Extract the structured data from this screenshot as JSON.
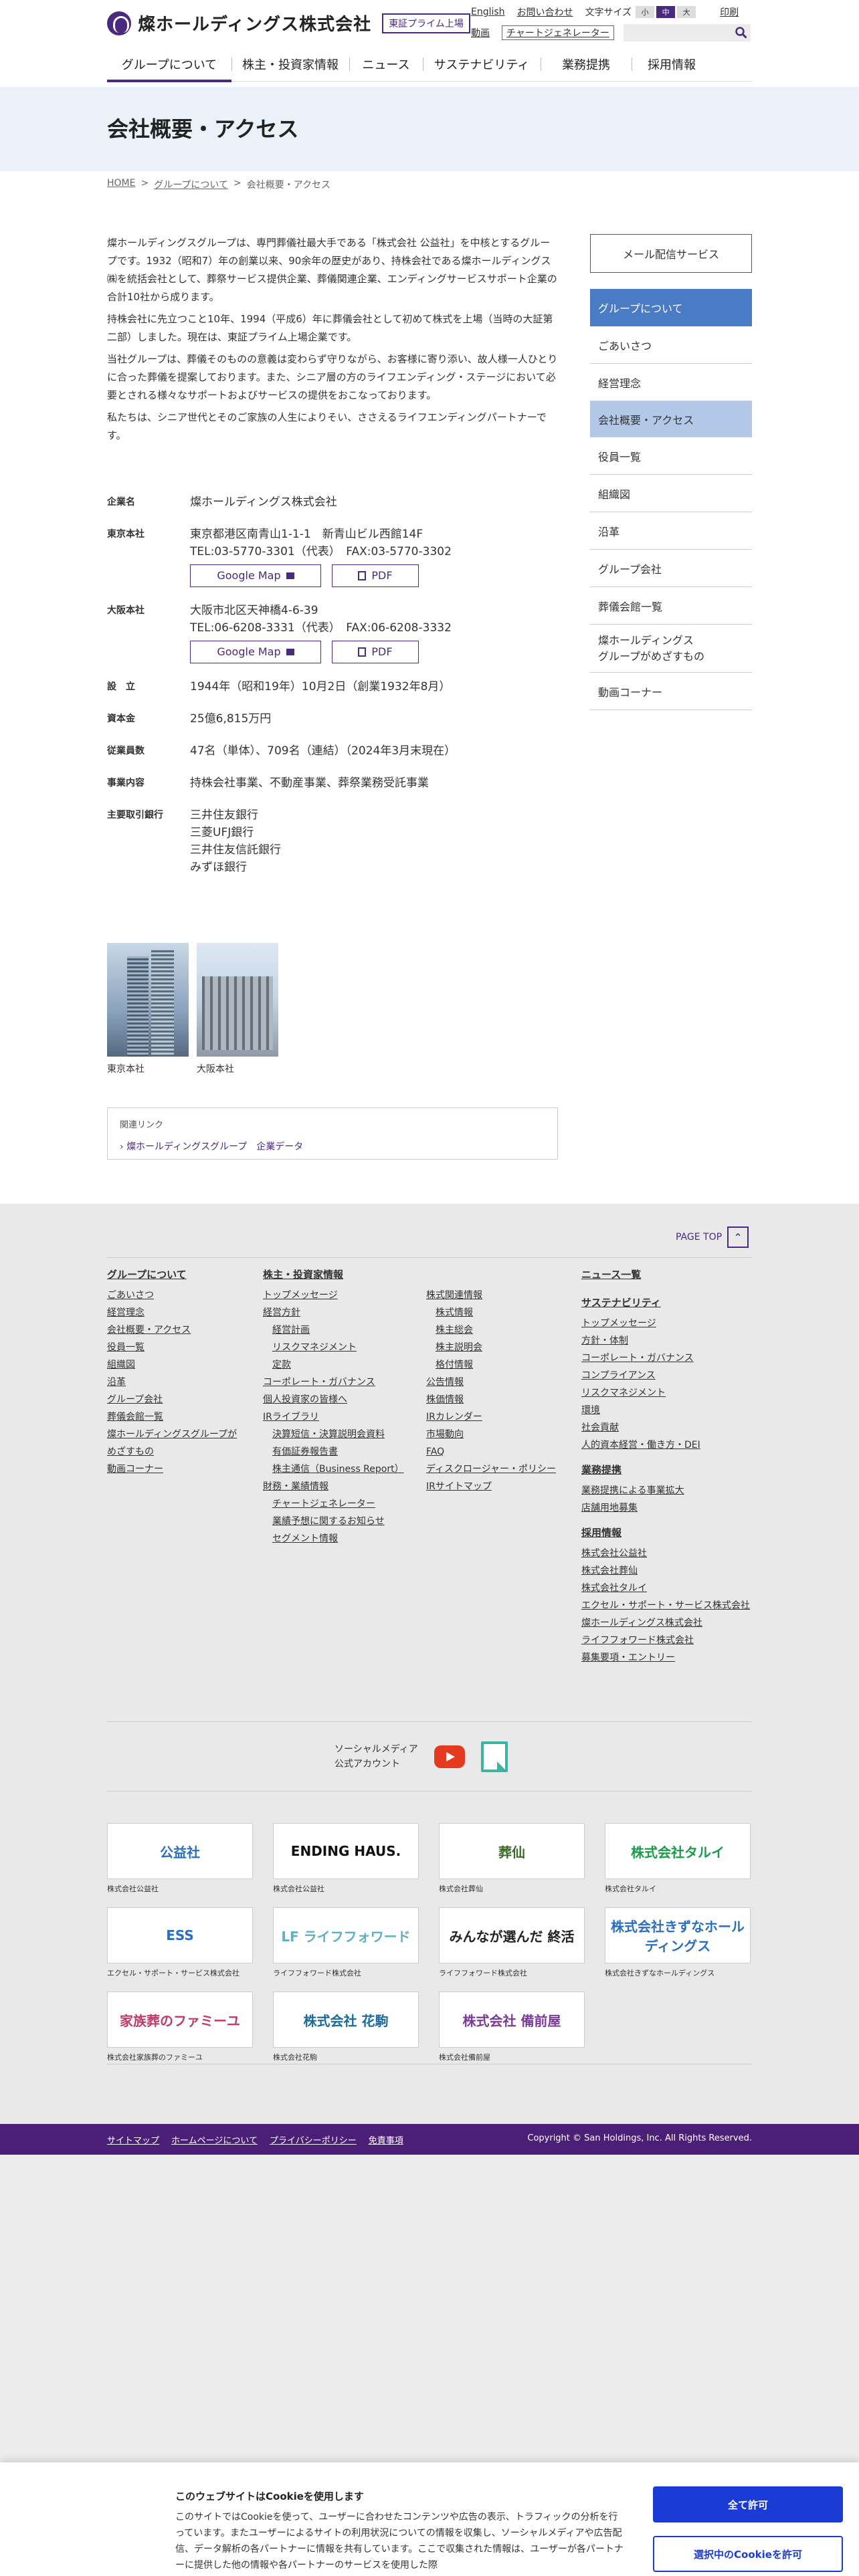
{
  "header": {
    "logo_text": "燦ホールディングス株式会社",
    "prime_badge": "東証プライム上場",
    "util": {
      "english": "English",
      "contact": "お問い合わせ",
      "font_size": "文字サイズ",
      "fs_small": "小",
      "fs_mid": "中",
      "fs_large": "大",
      "print": "印刷",
      "video": "動画",
      "chart_gen": "チャートジェネレーター"
    },
    "search_placeholder": "",
    "nav": [
      "グループについて",
      "株主・投資家情報",
      "ニュース",
      "サステナビリティ",
      "業務提携",
      "採用情報"
    ]
  },
  "hero": {
    "title": "会社概要・アクセス"
  },
  "breadcrumb": {
    "home": "HOME",
    "sep": ">",
    "group": "グループについて",
    "current": "会社概要・アクセス"
  },
  "intro": [
    "燦ホールディングスグループは、専門葬儀社最大手である「株式会社 公益社」を中核とするグループです。1932（昭和7）年の創業以来、90余年の歴史があり、持株会社である燦ホールディングス㈱を統括会社として、葬祭サービス提供企業、葬儀関連企業、エンディングサービスサポート企業の合計10社から成ります。",
    "持株会社に先立つこと10年、1994（平成6）年に葬儀会社として初めて株式を上場（当時の大証第二部）しました。現在は、東証プライム上場企業です。",
    "当社グループは、葬儀そのものの意義は変わらず守りながら、お客様に寄り添い、故人様一人ひとりに合った葬儀を提案しております。また、シニア層の方のライフエンディング・ステージにおいて必要とされる様々なサポートおよびサービスの提供をおこなっております。",
    "私たちは、シニア世代とそのご家族の人生によりそい、ささえるライフエンディングパートナーです。"
  ],
  "profile": {
    "company_label": "企業名",
    "company_value": "燦ホールディングス株式会社",
    "tokyo_label": "東京本社",
    "tokyo_addr": "東京都港区南青山1-1-1　新青山ビル西館14F",
    "tokyo_tel": "TEL:03-5770-3301（代表）　FAX:03-5770-3302",
    "osaka_label": "大阪本社",
    "osaka_addr": "大阪市北区天神橋4-6-39",
    "osaka_tel": "TEL:06-6208-3331（代表）　FAX:06-6208-3332",
    "google_map": "Google Map",
    "pdf": "PDF",
    "est_label": "設　立",
    "est_value": "1944年（昭和19年）10月2日（創業1932年8月）",
    "capital_label": "資本金",
    "capital_value": "25億6,815万円",
    "staff_label": "従業員数",
    "staff_value": "47名（単体）、709名（連結）（2024年3月末現在）",
    "biz_label": "事業内容",
    "biz_value": "持株会社事業、不動産事業、葬祭業務受託事業",
    "bank_label": "主要取引銀行",
    "banks": [
      "三井住友銀行",
      "三菱UFJ銀行",
      "三井住友信託銀行",
      "みずほ銀行"
    ]
  },
  "photos": {
    "tokyo": "東京本社",
    "osaka": "大阪本社"
  },
  "related": {
    "title": "関連リンク",
    "link": "燦ホールディングスグループ　企業データ"
  },
  "side": {
    "mail": "メール配信サービス",
    "items": [
      "グループについて",
      "ごあいさつ",
      "経営理念",
      "会社概要・アクセス",
      "役員一覧",
      "組織図",
      "沿革",
      "グループ会社",
      "葬儀会館一覧",
      "燦ホールディングス\nグループがめざすもの",
      "動画コーナー"
    ]
  },
  "footer": {
    "pagetop": "PAGE TOP",
    "col1_head": "グループについて",
    "col1": [
      "ごあいさつ",
      "経営理念",
      "会社概要・アクセス",
      "役員一覧",
      "組織図",
      "沿革",
      "グループ会社",
      "葬儀会館一覧",
      "燦ホールディングスグループが",
      "めざすもの",
      "動画コーナー"
    ],
    "col2_head": "株主・投資家情報",
    "col2": [
      "トップメッセージ",
      "経営方針",
      "経営計画",
      "リスクマネジメント",
      "定款",
      "コーポレート・ガバナンス",
      "個人投資家の皆様へ",
      "IRライブラリ",
      "決算短信・決算説明会資料",
      "有価証券報告書",
      "株主通信（Business Report）",
      "財務・業績情報",
      "チャートジェネレーター",
      "業績予想に関するお知らせ",
      "セグメント情報"
    ],
    "col3": [
      "株式関連情報",
      "株式情報",
      "株主総会",
      "株主説明会",
      "格付情報",
      "公告情報",
      "株価情報",
      "IRカレンダー",
      "市場動向",
      "FAQ",
      "ディスクロージャー・ポリシー",
      "IRサイトマップ"
    ],
    "col4_news": "ニュース一覧",
    "col4_sus_head": "サステナビリティ",
    "col4_sus": [
      "トップメッセージ",
      "方針・体制",
      "コーポレート・ガバナンス",
      "コンプライアンス",
      "リスクマネジメント",
      "環境",
      "社会貢献",
      "人的資本経営・働き方・DEI"
    ],
    "col4_biz_head": "業務提携",
    "col4_biz": [
      "業務提携による事業拡大",
      "店舗用地募集"
    ],
    "col4_rec_head": "採用情報",
    "col4_rec": [
      "株式会社公益社",
      "株式会社葬仙",
      "株式会社タルイ",
      "エクセル・サポート・サービス株式会社",
      "燦ホールディングス株式会社",
      "ライフフォワード株式会社",
      "募集要項・エントリー"
    ],
    "social": [
      "ソーシャルメディア",
      "公式アカウント"
    ],
    "logos": [
      {
        "name": "公益社",
        "cap": "株式会社公益社",
        "color": "#2a6fbf"
      },
      {
        "name": "ENDING HAUS.",
        "cap": "株式会社公益社",
        "color": "#111111"
      },
      {
        "name": "葬仙",
        "cap": "株式会社葬仙",
        "color": "#3a6a2a"
      },
      {
        "name": "株式会社タルイ",
        "cap": "株式会社タルイ",
        "color": "#1a9a4a"
      },
      {
        "name": "ESS",
        "cap": "エクセル・サポート・サービス株式会社",
        "color": "#2a6fbf"
      },
      {
        "name": "LF ライフフォワード",
        "cap": "ライフフォワード株式会社",
        "color": "#5fb0c0"
      },
      {
        "name": "みんなが選んだ 終活",
        "cap": "ライフフォワード株式会社",
        "color": "#222222"
      },
      {
        "name": "株式会社きずなホールディングス",
        "cap": "株式会社きずなホールディングス",
        "color": "#2a6fbf"
      },
      {
        "name": "家族葬のファミーユ",
        "cap": "株式会社家族葬のファミーユ",
        "color": "#c03a6a"
      },
      {
        "name": "株式会社 花駒",
        "cap": "株式会社花駒",
        "color": "#1a6a9a"
      },
      {
        "name": "株式会社 備前屋",
        "cap": "株式会社備前屋",
        "color": "#7a3a9a"
      }
    ],
    "bottom_links": [
      "サイトマップ",
      "ホームページについて",
      "プライバシーポリシー",
      "免責事項"
    ],
    "copyright": "Copyright © San Holdings, Inc. All Rights Reserved."
  },
  "cookie": {
    "title": "このウェブサイトはCookieを使用します",
    "body": "このサイトではCookieを使って、ユーザーに合わせたコンテンツや広告の表示、トラフィックの分析を行っています。またユーザーによるサイトの利用状況についての情報を収集し、ソーシャルメディアや広告配信、データ解析の各パートナーに情報を共有しています。ここで収集された情報は、ユーザーが各パートナーに提供した他の情報や各パートナーのサービスを使用した際",
    "accept_all": "全て許可",
    "accept_selected": "選択中のCookieを許可"
  }
}
